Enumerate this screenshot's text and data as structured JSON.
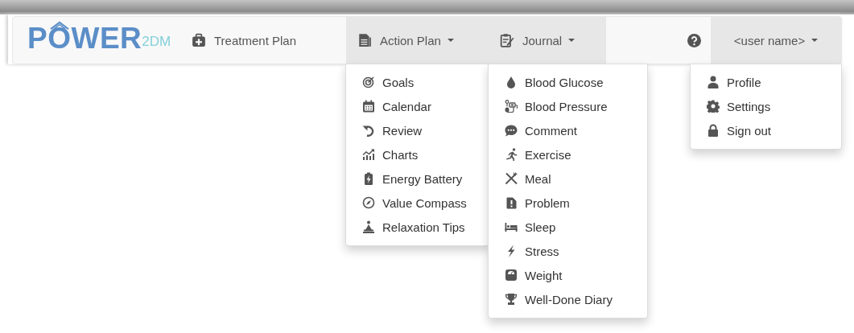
{
  "logo": {
    "main": "POWER",
    "suffix": "2DM"
  },
  "nav": [
    {
      "label": "Treatment Plan",
      "expanded": false
    },
    {
      "label": "Action Plan",
      "expanded": true,
      "menu": [
        "Goals",
        "Calendar",
        "Review",
        "Charts",
        "Energy Battery",
        "Value Compass",
        "Relaxation Tips"
      ]
    },
    {
      "label": "Journal",
      "expanded": true,
      "menu": [
        "Blood Glucose",
        "Blood Pressure",
        "Comment",
        "Exercise",
        "Meal",
        "Problem",
        "Sleep",
        "Stress",
        "Weight",
        "Well-Done Diary"
      ]
    }
  ],
  "user": {
    "label": "<user name>",
    "expanded": true,
    "menu": [
      "Profile",
      "Settings",
      "Sign out"
    ]
  }
}
